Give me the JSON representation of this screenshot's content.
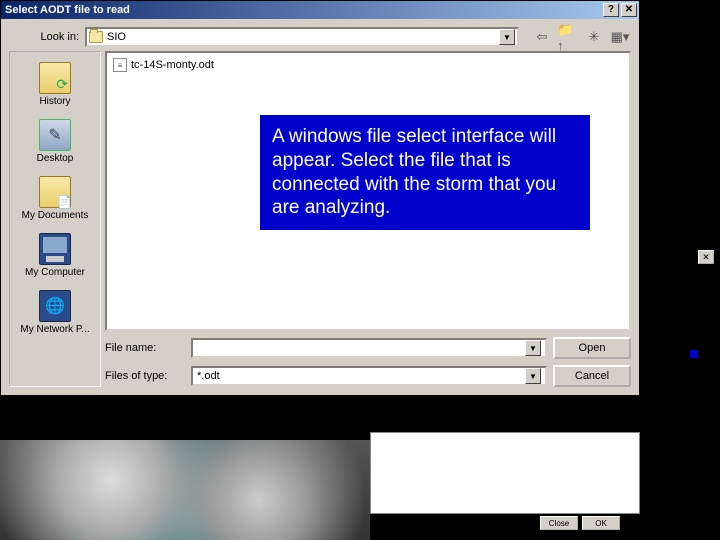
{
  "title": "Select AODT file to read",
  "titlebar": {
    "help": "?",
    "close": "✕"
  },
  "lookin": {
    "label": "Look in:",
    "value": "SIO"
  },
  "toolbar": {
    "back": "⇦",
    "up": "📁↑",
    "new": "✳",
    "view": "▦▾"
  },
  "places": [
    {
      "label": "History",
      "icon": "history"
    },
    {
      "label": "Desktop",
      "icon": "desktop"
    },
    {
      "label": "My Documents",
      "icon": "mydocs"
    },
    {
      "label": "My Computer",
      "icon": "mycomp"
    },
    {
      "label": "My Network P...",
      "icon": "netp"
    }
  ],
  "files": [
    {
      "name": "tc-14S-monty.odt"
    }
  ],
  "filename": {
    "label": "File name:",
    "value": ""
  },
  "filetype": {
    "label": "Files of type:",
    "value": "*.odt"
  },
  "buttons": {
    "open": "Open",
    "cancel": "Cancel"
  },
  "instruction": "A windows file select interface will appear. Select the file that is connected with the storm that you are analyzing.",
  "lower": {
    "close": "Close",
    "ok": "OK"
  },
  "strip": {
    "close": "✕"
  }
}
